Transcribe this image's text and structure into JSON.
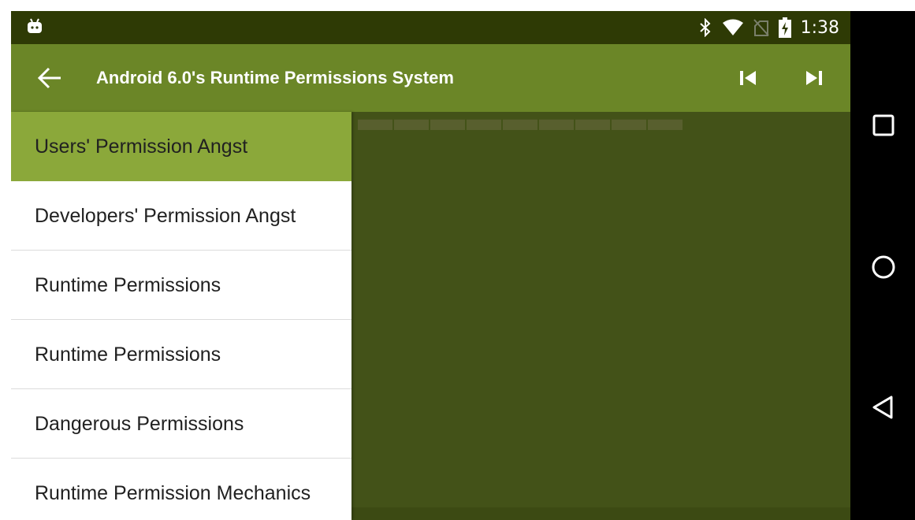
{
  "status_bar": {
    "time": "1:38",
    "left_icon": "android-debug-icon",
    "right_icons": [
      "bluetooth-icon",
      "wifi-icon",
      "no-sim-icon",
      "battery-charging-icon"
    ]
  },
  "toolbar": {
    "title": "Android 6.0's Runtime Permissions System",
    "back_icon": "arrow-back-icon",
    "prev_icon": "skip-previous-icon",
    "next_icon": "skip-next-icon",
    "color": "#6b8627"
  },
  "drawer": {
    "items": [
      {
        "label": "Users' Permission Angst",
        "selected": true
      },
      {
        "label": "Developers' Permission Angst",
        "selected": false
      },
      {
        "label": "Runtime Permissions",
        "selected": false
      },
      {
        "label": "Runtime Permissions",
        "selected": false
      },
      {
        "label": "Dangerous Permissions",
        "selected": false
      },
      {
        "label": "Runtime Permission Mechanics",
        "selected": false
      }
    ],
    "selected_color": "#8ba83a"
  },
  "navigation_bar": {
    "buttons": [
      "recents-square-icon",
      "home-circle-icon",
      "back-triangle-icon"
    ]
  }
}
